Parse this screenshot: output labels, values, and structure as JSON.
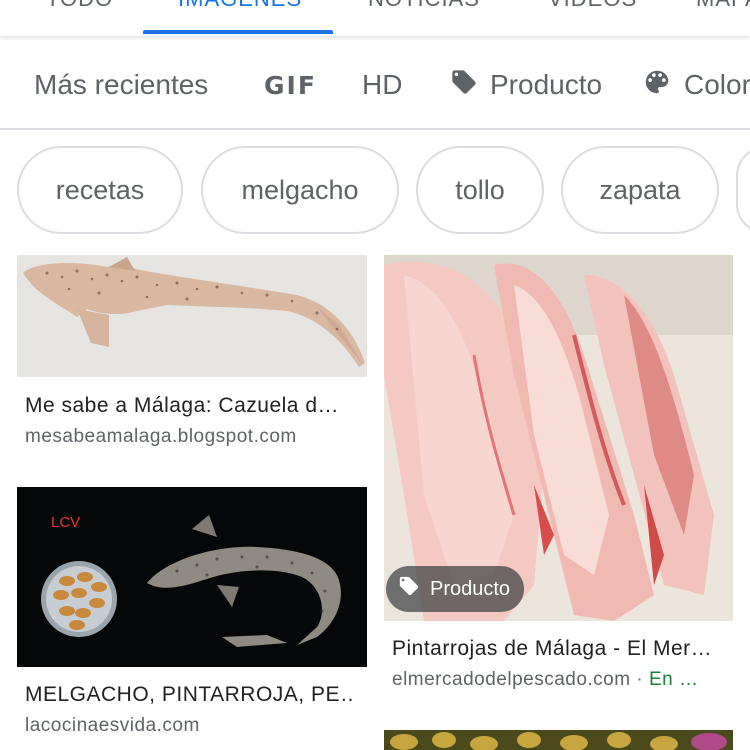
{
  "tabs": [
    {
      "label": "TODO"
    },
    {
      "label": "IMÁGENES"
    },
    {
      "label": "NOTICIAS"
    },
    {
      "label": "VÍDEOS"
    },
    {
      "label": "MAPAS"
    }
  ],
  "filters": {
    "recent": "Más recientes",
    "gif": "GIF",
    "hd": "HD",
    "product": "Producto",
    "color": "Color"
  },
  "chips": [
    "recetas",
    "melgacho",
    "tollo",
    "zapata"
  ],
  "results": [
    {
      "title": "Me sabe a Málaga: Cazuela d…",
      "source": "mesabeamalaga.blogspot.com"
    },
    {
      "title": "Pintarrojas de Málaga - El Mer…",
      "source": "elmercadodelpescado.com",
      "stock_sep": " · ",
      "stock": "En …",
      "badge": "Producto"
    },
    {
      "title": "MELGACHO, PINTARROJA, PE…",
      "source": "lacocinaesvida.com",
      "image_text": "LCV"
    }
  ],
  "colors": {
    "accent": "#1a73e8",
    "stock_green": "#188038",
    "label_red": "#e53935"
  },
  "icons": [
    "tag-icon",
    "palette-icon",
    "tag-icon"
  ]
}
